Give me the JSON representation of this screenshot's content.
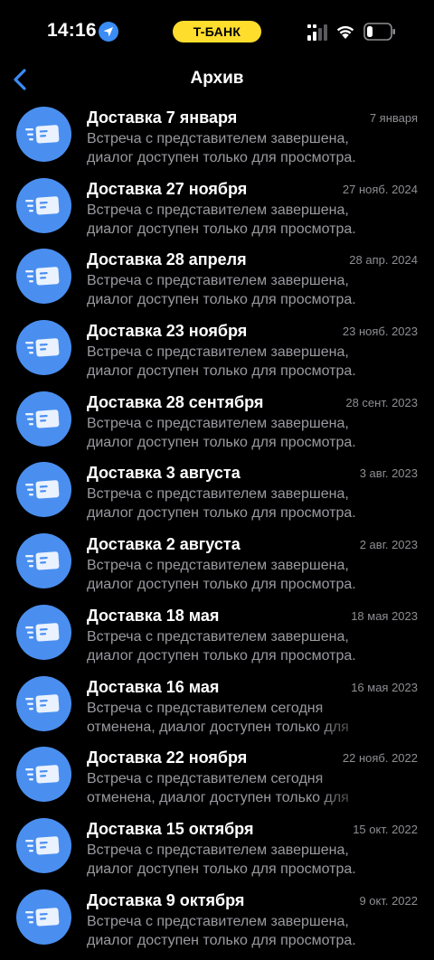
{
  "status_bar": {
    "time": "14:16",
    "bank_label": "T-БАНК",
    "bank_color": "#ffdd2d"
  },
  "nav": {
    "title": "Архив",
    "back_icon": "chevron-left-icon",
    "accent": "#3b8cf5"
  },
  "items": [
    {
      "title": "Доставка 7 января",
      "date": "7 января",
      "text": "Встреча с представителем завершена, диалог доступен только для просмотра."
    },
    {
      "title": "Доставка 27 ноября",
      "date": "27 нояб. 2024",
      "text": "Встреча с представителем завершена, диалог доступен только для просмотра."
    },
    {
      "title": "Доставка 28 апреля",
      "date": "28 апр. 2024",
      "text": "Встреча с представителем завершена, диалог доступен только для просмотра."
    },
    {
      "title": "Доставка 23 ноября",
      "date": "23 нояб. 2023",
      "text": "Встреча с представителем завершена, диалог доступен только для просмотра."
    },
    {
      "title": "Доставка 28 сентября",
      "date": "28 сент. 2023",
      "text": "Встреча с представителем завершена, диалог доступен только для просмотра."
    },
    {
      "title": "Доставка 3 августа",
      "date": "3 авг. 2023",
      "text": "Встреча с представителем завершена, диалог доступен только для просмотра."
    },
    {
      "title": "Доставка 2 августа",
      "date": "2 авг. 2023",
      "text": "Встреча с представителем завершена, диалог доступен только для просмотра."
    },
    {
      "title": "Доставка 18 мая",
      "date": "18 мая 2023",
      "text": "Встреча с представителем завершена, диалог доступен только для просмотра."
    },
    {
      "title": "Доставка 16 мая",
      "date": "16 мая 2023",
      "text": "Встреча с представителем сегодня отменена, диалог доступен только для просмотра."
    },
    {
      "title": "Доставка 22 ноября",
      "date": "22 нояб. 2022",
      "text": "Встреча с представителем сегодня отменена, диалог доступен только для просмотра."
    },
    {
      "title": "Доставка 15 октября",
      "date": "15 окт. 2022",
      "text": "Встреча с представителем завершена, диалог доступен только для просмотра."
    },
    {
      "title": "Доставка 9 октября",
      "date": "9 окт. 2022",
      "text": "Встреча с представителем завершена, диалог доступен только для просмотра."
    }
  ],
  "item_icon": "delivery-card-icon",
  "avatar_color": "#4a8ff0"
}
